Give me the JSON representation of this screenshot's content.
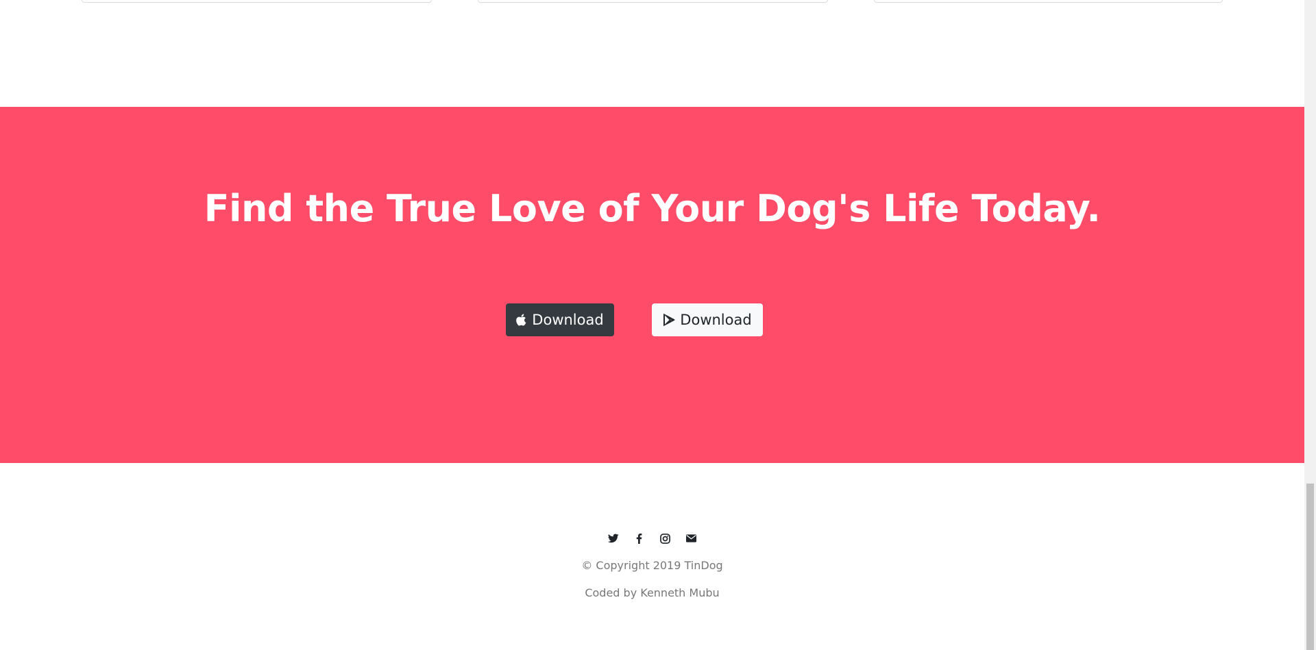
{
  "cta": {
    "title": "Find the True Love of Your Dog's Life Today.",
    "background_color": "#ff4c68",
    "apple_button": {
      "label": "Download",
      "icon": "apple-icon",
      "color": "#343a40"
    },
    "google_play_button": {
      "label": "Download",
      "icon": "google-play-icon",
      "color": "#f8f9fa"
    }
  },
  "footer": {
    "social_icons": [
      "twitter-icon",
      "facebook-icon",
      "instagram-icon",
      "envelope-icon"
    ],
    "copyright": "© Copyright 2019 TinDog",
    "credit": "Coded by Kenneth Mubu"
  }
}
